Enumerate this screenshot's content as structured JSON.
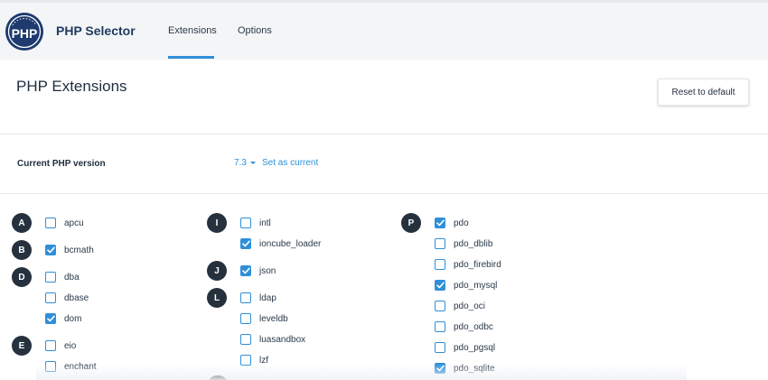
{
  "header": {
    "logo_text": "PHP",
    "app_title": "PHP Selector",
    "tabs": [
      {
        "label": "Extensions",
        "active": true
      },
      {
        "label": "Options",
        "active": false
      }
    ]
  },
  "page": {
    "title": "PHP Extensions",
    "reset_label": "Reset to default"
  },
  "version": {
    "label": "Current PHP version",
    "selected": "7.3",
    "set_current_label": "Set as current"
  },
  "colors": {
    "accent": "#2f8fd8",
    "badge": "#25313d",
    "logo": "#1e3a6e"
  },
  "extensions": {
    "columns": [
      {
        "groups": [
          {
            "letter": "A",
            "items": [
              {
                "name": "apcu",
                "checked": false
              }
            ]
          },
          {
            "letter": "B",
            "items": [
              {
                "name": "bcmath",
                "checked": true
              }
            ]
          },
          {
            "letter": "D",
            "items": [
              {
                "name": "dba",
                "checked": false
              },
              {
                "name": "dbase",
                "checked": false
              },
              {
                "name": "dom",
                "checked": true
              }
            ]
          },
          {
            "letter": "E",
            "items": [
              {
                "name": "eio",
                "checked": false
              },
              {
                "name": "enchant",
                "checked": false
              }
            ]
          }
        ]
      },
      {
        "groups": [
          {
            "letter": "I",
            "items": [
              {
                "name": "intl",
                "checked": false
              },
              {
                "name": "ioncube_loader",
                "checked": true
              }
            ]
          },
          {
            "letter": "J",
            "items": [
              {
                "name": "json",
                "checked": true
              }
            ]
          },
          {
            "letter": "L",
            "items": [
              {
                "name": "ldap",
                "checked": false
              },
              {
                "name": "leveldb",
                "checked": false
              },
              {
                "name": "luasandbox",
                "checked": false
              },
              {
                "name": "lzf",
                "checked": false
              }
            ]
          }
        ]
      },
      {
        "groups": [
          {
            "letter": "P",
            "items": [
              {
                "name": "pdo",
                "checked": true
              },
              {
                "name": "pdo_dblib",
                "checked": false
              },
              {
                "name": "pdo_firebird",
                "checked": false
              },
              {
                "name": "pdo_mysql",
                "checked": true
              },
              {
                "name": "pdo_oci",
                "checked": false
              },
              {
                "name": "pdo_odbc",
                "checked": false
              },
              {
                "name": "pdo_pgsql",
                "checked": false
              },
              {
                "name": "pdo_sqlite",
                "checked": true
              }
            ]
          }
        ]
      }
    ]
  }
}
